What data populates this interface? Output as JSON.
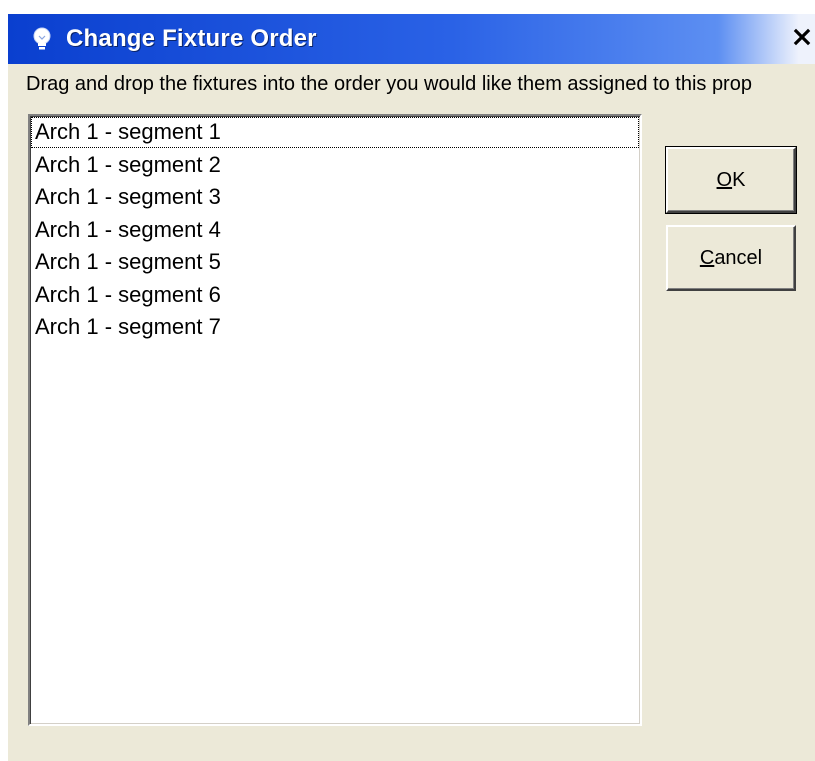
{
  "window": {
    "title": "Change Fixture Order",
    "icon": "lightbulb-icon",
    "close_icon": "close-icon",
    "title_gradient": [
      "#0a3fcf",
      "#eef2fc"
    ]
  },
  "instruction": "Drag and drop the fixtures into the order you would like them assigned to this prop",
  "fixtures": [
    "Arch 1 - segment 1",
    "Arch 1 - segment 2",
    "Arch 1 - segment 3",
    "Arch 1 - segment 4",
    "Arch 1 - segment 5",
    "Arch 1 - segment 6",
    "Arch 1 - segment 7"
  ],
  "focused_index": 0,
  "buttons": {
    "ok": {
      "mnemonic": "O",
      "rest": "K"
    },
    "cancel": {
      "mnemonic": "C",
      "rest": "ancel"
    }
  },
  "colors": {
    "dialog_bg": "#ece9d8",
    "list_bg": "#ffffff",
    "title_text": "#ffffff"
  }
}
